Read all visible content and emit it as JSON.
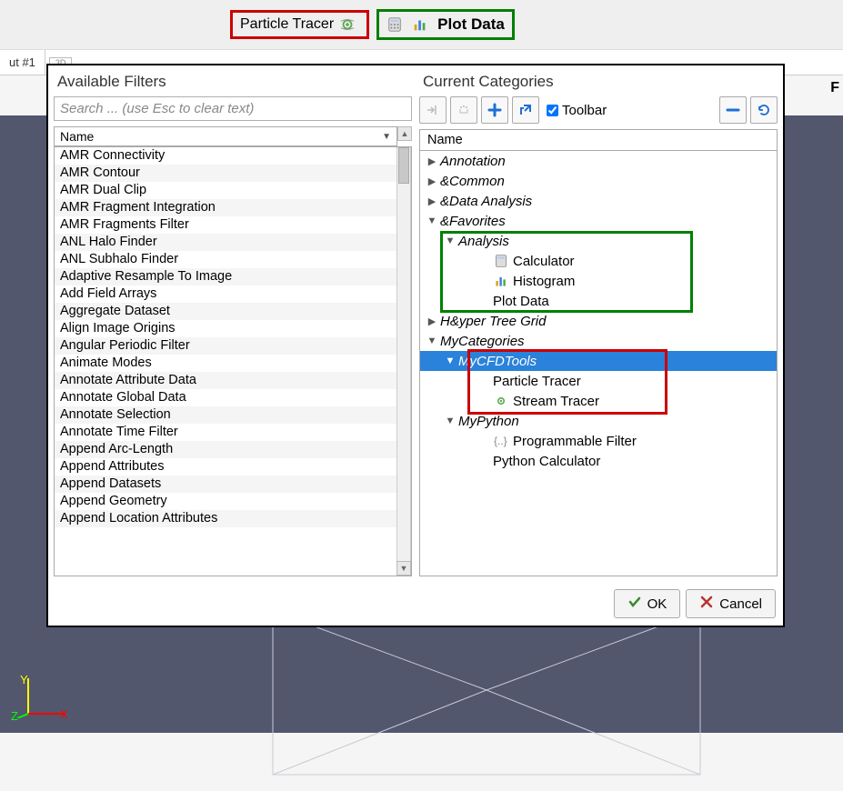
{
  "top_toolbar": {
    "particle_tracer_label": "Particle Tracer",
    "plot_data_label": "Plot Data"
  },
  "tabs": {
    "layout_label": "ut #1",
    "view_3d_label": "3D"
  },
  "axis": {
    "x": "X",
    "y": "Y",
    "z": "Z"
  },
  "dialog": {
    "left_title": "Available Filters",
    "right_title": "Current Categories",
    "search_placeholder": "Search ... (use Esc to clear text)",
    "name_header": "Name",
    "filters": [
      "AMR Connectivity",
      "AMR Contour",
      "AMR Dual Clip",
      "AMR Fragment Integration",
      "AMR Fragments Filter",
      "ANL Halo Finder",
      "ANL Subhalo Finder",
      "Adaptive Resample To Image",
      "Add Field Arrays",
      "Aggregate Dataset",
      "Align Image Origins",
      "Angular Periodic Filter",
      "Animate Modes",
      "Annotate Attribute Data",
      "Annotate Global Data",
      "Annotate Selection",
      "Annotate Time Filter",
      "Append Arc-Length",
      "Append Attributes",
      "Append Datasets",
      "Append Geometry",
      "Append Location Attributes"
    ],
    "toolbar_checkbox_label": "Toolbar",
    "tree_header": "Name",
    "tree": {
      "annotation": "Annotation",
      "common": "&Common",
      "data_analysis": "&Data Analysis",
      "favorites": "&Favorites",
      "analysis": "Analysis",
      "calculator": "Calculator",
      "histogram": "Histogram",
      "plot_data": "Plot Data",
      "hyper_tree": "H&yper Tree Grid",
      "my_categories": "MyCategories",
      "my_cfd_tools": "MyCFDTools",
      "particle_tracer": "Particle Tracer",
      "stream_tracer": "Stream Tracer",
      "my_python": "MyPython",
      "prog_filter": "Programmable Filter",
      "python_calc": "Python Calculator"
    },
    "ok_label": "OK",
    "cancel_label": "Cancel"
  }
}
